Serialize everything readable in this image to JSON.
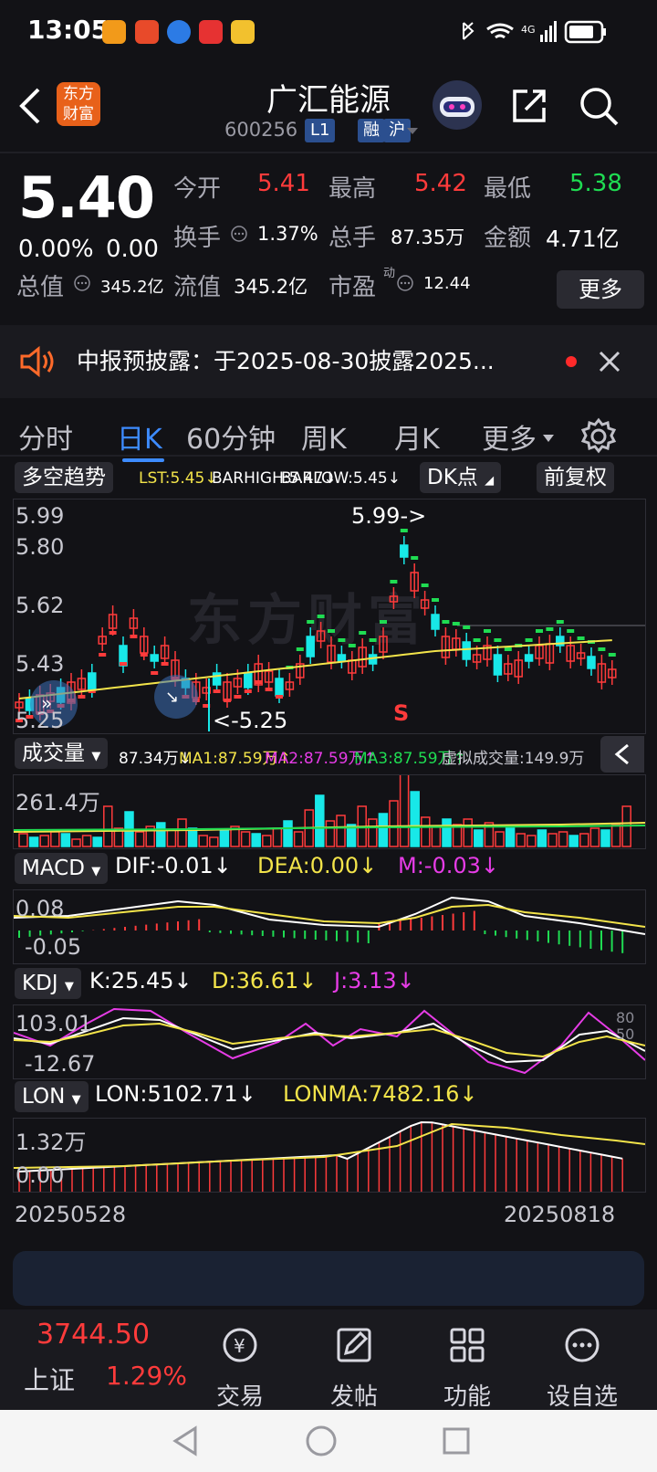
{
  "status": {
    "time": "13:05",
    "network": "4G"
  },
  "header": {
    "back_icon": "chevron-left-icon",
    "logo_text": "东方财富",
    "title": "广汇能源",
    "code": "600256",
    "badge_l1": "L1",
    "badge_rong": "融",
    "badge_hu": "沪"
  },
  "quote": {
    "price": "5.40",
    "change_pct": "0.00%",
    "change_amt": "0.00",
    "rows": [
      [
        {
          "label": "今开",
          "value": "5.41",
          "color": "#ff3b3b"
        },
        {
          "label": "最高",
          "value": "5.42",
          "color": "#ff3b3b"
        },
        {
          "label": "最低",
          "value": "5.38",
          "color": "#1fdc52"
        }
      ],
      [
        {
          "label": "换手",
          "value": "1.37%",
          "color": "#ffffff"
        },
        {
          "label": "总手",
          "value": "87.35万",
          "color": "#ffffff"
        },
        {
          "label": "金额",
          "value": "4.71亿",
          "color": "#ffffff"
        }
      ],
      [
        {
          "label": "总值",
          "value": "345.2亿",
          "color": "#ffffff"
        },
        {
          "label": "流值",
          "value": "345.2亿",
          "color": "#ffffff"
        },
        {
          "label": "市盈",
          "sup": "动",
          "value": "12.44",
          "color": "#ffffff"
        }
      ]
    ],
    "more_label": "更多"
  },
  "notice": {
    "text": "中报预披露：于2025-08-30披露2025..."
  },
  "tabs": [
    {
      "label": "分时"
    },
    {
      "label": "日K"
    },
    {
      "label": "60分钟"
    },
    {
      "label": "周K"
    },
    {
      "label": "月K"
    },
    {
      "label": "更多"
    }
  ],
  "kline_toolbar": {
    "indicator": "多空趋势",
    "lst": "LST:5.45↓",
    "barhigh": "BARHIGH:5.47↓",
    "barlow": "BARLOW:5.45↓",
    "dk_label": "DK点",
    "adjust_label": "前复权"
  },
  "kline": {
    "axis": [
      "5.99",
      "5.80",
      "5.62",
      "5.43",
      "5.25"
    ],
    "max_label": "5.99->",
    "min_label": "<-5.25",
    "signal": "S"
  },
  "volume": {
    "label": "成交量",
    "value": "87.34万↓",
    "ma1": "MA1:87.59万↑",
    "ma2": "MA2:87.59万↑",
    "ma3": "MA3:87.59万↑",
    "virtual": "虚拟成交量:149.9万",
    "axis_top": "261.4万"
  },
  "macd": {
    "label": "MACD",
    "dif": "DIF:-0.01↓",
    "dea": "DEA:0.00↓",
    "m": "M:-0.03↓",
    "axis_top": "0.08",
    "axis_bottom": "-0.05"
  },
  "kdj": {
    "label": "KDJ",
    "k": "K:25.45↓",
    "d": "D:36.61↓",
    "j": "J:3.13↓",
    "axis_top": "103.01",
    "axis_bottom": "-12.67",
    "right_80": "80",
    "right_50": "50"
  },
  "lon": {
    "label": "LON",
    "lon": "LON:5102.71↓",
    "lonma": "LONMA:7482.16↓",
    "axis_top": "1.32万",
    "axis_bottom": "0.00"
  },
  "dates": {
    "start": "20250528",
    "end": "20250818"
  },
  "bottom_nav": {
    "index_value": "3744.50",
    "index_name": "上证",
    "index_pct": "1.29%",
    "items": [
      {
        "label": "交易",
        "icon": "trade-icon"
      },
      {
        "label": "发帖",
        "icon": "edit-icon"
      },
      {
        "label": "功能",
        "icon": "grid-icon"
      },
      {
        "label": "设自选",
        "icon": "more-circle-icon"
      }
    ]
  },
  "colors": {
    "up": "#ff3b3b",
    "down": "#1fdc52",
    "accent": "#3d8bff",
    "cyan": "#18e8e8",
    "yellow": "#f3e44a",
    "magenta": "#e63ce6"
  }
}
